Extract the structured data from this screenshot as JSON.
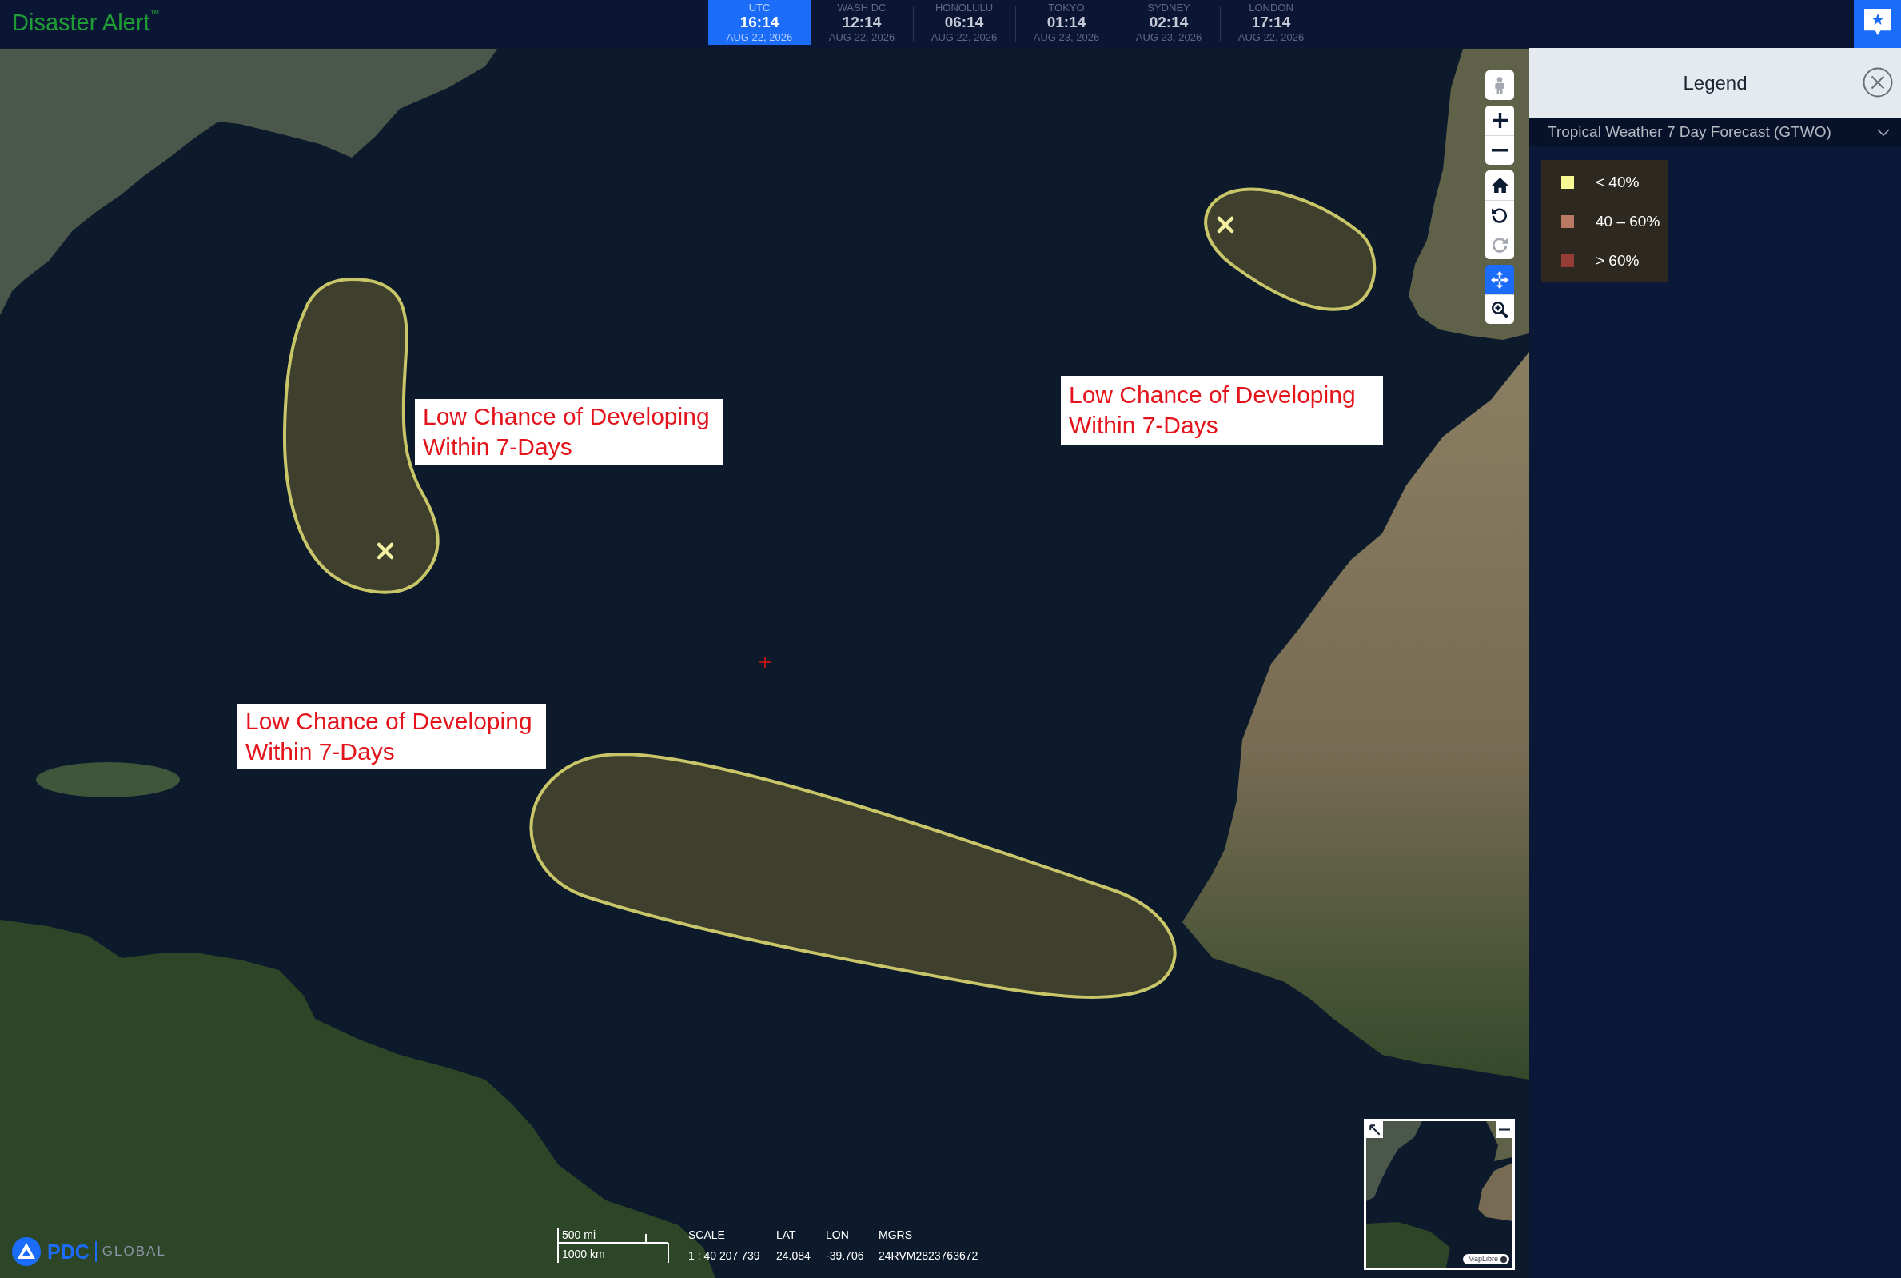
{
  "header": {
    "title": "Disaster Alert$^{™}$",
    "clocks": [
      {
        "city": "UTC",
        "time": "16:14",
        "date": "AUG 22, 2026",
        "selected": true
      },
      {
        "city": "WASH DC",
        "time": "12:14",
        "date": "AUG 22, 2026",
        "selected": false
      },
      {
        "city": "HONOLULU",
        "time": "06:14",
        "date": "AUG 22, 2026",
        "selected": false
      },
      {
        "city": "TOKYO",
        "time": "01:14",
        "date": "AUG 23, 2026",
        "selected": false
      },
      {
        "city": "SYDNEY",
        "time": "02:14",
        "date": "AUG 23, 2026",
        "selected": false
      },
      {
        "city": "LONDON",
        "time": "17:14",
        "date": "AUG 22, 2026",
        "selected": false
      }
    ]
  },
  "map": {
    "forecast_areas": [
      {
        "label": "Low Chance of Developing Within 7-Days",
        "center_marker": true
      },
      {
        "label": "Low Chance of Developing Within 7-Days",
        "center_marker": true
      },
      {
        "label": "Low Chance of Developing Within 7-Days",
        "center_marker": false
      }
    ],
    "tool_groups": [
      {
        "tools": [
          {
            "kind": "street-view",
            "selected": false,
            "disabled": true
          }
        ]
      },
      {
        "tools": [
          {
            "kind": "zoom-in",
            "selected": false,
            "disabled": false
          },
          {
            "kind": "zoom-out",
            "selected": false,
            "disabled": false
          }
        ]
      },
      {
        "tools": [
          {
            "kind": "home",
            "selected": false,
            "disabled": false
          },
          {
            "kind": "rotate-left",
            "selected": false,
            "disabled": false
          },
          {
            "kind": "rotate-right",
            "selected": false,
            "disabled": true
          }
        ]
      },
      {
        "tools": [
          {
            "kind": "pan",
            "selected": true,
            "disabled": false
          },
          {
            "kind": "zoom-box",
            "selected": false,
            "disabled": false
          }
        ]
      }
    ],
    "logo": {
      "name": "PDC",
      "tagline": "GLOBAL"
    },
    "scale_bar": {
      "imperial": "500 mi",
      "metric": "1000 km"
    },
    "readouts": [
      {
        "label": "SCALE",
        "value": "1 : 40 207 739"
      },
      {
        "label": "LAT",
        "value": "24.084"
      },
      {
        "label": "LON",
        "value": "-39.706"
      },
      {
        "label": "MGRS",
        "value": "24RVM2823763672"
      }
    ],
    "overview_map": {
      "attribution": "MapLibre"
    }
  },
  "legend": {
    "title": "Legend",
    "layer": "Tropical Weather 7 Day Forecast (GTWO)",
    "entries": [
      {
        "label": "< 40%",
        "color": "#f8f894"
      },
      {
        "label": "40 – 60%",
        "color": "#b97a64"
      },
      {
        "label": "> 60%",
        "color": "#963c36"
      }
    ]
  }
}
